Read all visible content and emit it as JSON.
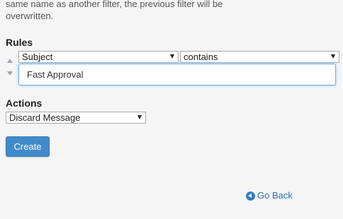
{
  "description": {
    "line1": "same name as another filter, the previous filter will be",
    "line2": "overwritten."
  },
  "rules": {
    "heading": "Rules",
    "field_select": "Subject",
    "operator_select": "contains",
    "value_input": "Fast Approval"
  },
  "actions": {
    "heading": "Actions",
    "action_select": "Discard Message"
  },
  "buttons": {
    "create": "Create"
  },
  "links": {
    "go_back": "Go Back"
  },
  "icons": {
    "move_up": "triangle-up-icon",
    "move_down": "triangle-down-icon",
    "go_back": "circle-arrow-left-icon"
  },
  "colors": {
    "primary_button": "#428bca",
    "link": "#2a6fb0",
    "focus_border": "#66afe9"
  }
}
